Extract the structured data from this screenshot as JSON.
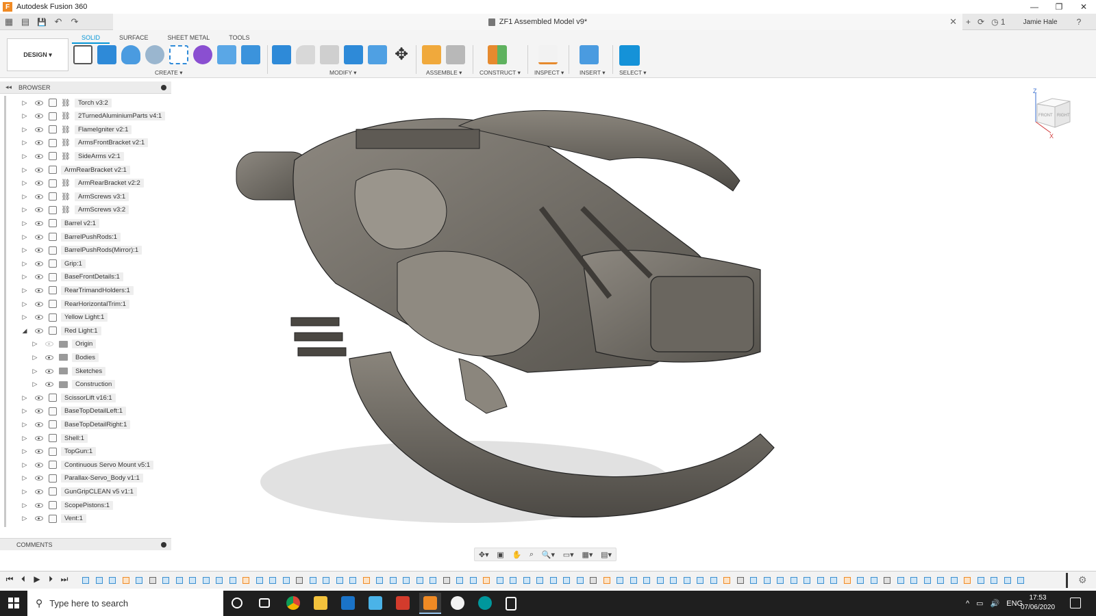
{
  "window": {
    "app_title": "Autodesk Fusion 360",
    "minimize": "—",
    "restore": "❐",
    "close": "✕"
  },
  "quickaccess": {
    "grid_icon": "▦",
    "file_icon": "▤",
    "save_icon": "💾",
    "undo_icon": "↶",
    "redo_icon": "↷"
  },
  "doc": {
    "title": "ZF1 Assembled Model v9*",
    "close": "✕"
  },
  "topright": {
    "new_tab": "+",
    "job_icon": "⟳",
    "notifications": "◷ 1",
    "user": "Jamie Hale",
    "help": "?"
  },
  "ribbon": {
    "workspace": "DESIGN ▾",
    "tabs": [
      "SOLID",
      "SURFACE",
      "SHEET METAL",
      "TOOLS"
    ],
    "groups": {
      "create": "CREATE ▾",
      "modify": "MODIFY ▾",
      "assemble": "ASSEMBLE ▾",
      "construct": "CONSTRUCT ▾",
      "inspect": "INSPECT ▾",
      "insert": "INSERT ▾",
      "select": "SELECT ▾"
    }
  },
  "browser": {
    "title": "BROWSER",
    "collapse": "◂◂",
    "items": [
      {
        "label": "Torch v3:2",
        "link": true,
        "expanded": false,
        "depth": 0
      },
      {
        "label": "2TurnedAluminiumParts v4:1",
        "link": true,
        "expanded": false,
        "depth": 0
      },
      {
        "label": "FlameIgniter v2:1",
        "link": true,
        "expanded": false,
        "depth": 0
      },
      {
        "label": "ArmsFrontBracket v2:1",
        "link": true,
        "expanded": false,
        "depth": 0
      },
      {
        "label": "SideArms v2:1",
        "link": true,
        "expanded": false,
        "depth": 0
      },
      {
        "label": "ArmRearBracket v2:1",
        "link": false,
        "expanded": false,
        "depth": 0
      },
      {
        "label": "ArmRearBracket v2:2",
        "link": true,
        "expanded": false,
        "depth": 0
      },
      {
        "label": "ArmScrews v3:1",
        "link": true,
        "expanded": false,
        "depth": 0
      },
      {
        "label": "ArmScrews v3:2",
        "link": true,
        "expanded": false,
        "depth": 0
      },
      {
        "label": "Barrel v2:1",
        "link": false,
        "expanded": false,
        "depth": 0
      },
      {
        "label": "BarrelPushRods:1",
        "link": false,
        "expanded": false,
        "depth": 0
      },
      {
        "label": "BarrelPushRods(Mirror):1",
        "link": false,
        "expanded": false,
        "depth": 0
      },
      {
        "label": "Grip:1",
        "link": false,
        "expanded": false,
        "depth": 0
      },
      {
        "label": "BaseFrontDetails:1",
        "link": false,
        "expanded": false,
        "depth": 0
      },
      {
        "label": "RearTrimandHolders:1",
        "link": false,
        "expanded": false,
        "depth": 0
      },
      {
        "label": "RearHorizontalTrim:1",
        "link": false,
        "expanded": false,
        "depth": 0
      },
      {
        "label": "Yellow Light:1",
        "link": false,
        "expanded": false,
        "depth": 0
      },
      {
        "label": "Red Light:1",
        "link": false,
        "expanded": true,
        "depth": 0
      },
      {
        "label": "Origin",
        "link": false,
        "expanded": false,
        "depth": 1,
        "folder": true,
        "hidden": true
      },
      {
        "label": "Bodies",
        "link": false,
        "expanded": false,
        "depth": 1,
        "folder": true
      },
      {
        "label": "Sketches",
        "link": false,
        "expanded": false,
        "depth": 1,
        "folder": true
      },
      {
        "label": "Construction",
        "link": false,
        "expanded": false,
        "depth": 1,
        "folder": true
      },
      {
        "label": "ScissorLift v16:1",
        "link": false,
        "expanded": false,
        "depth": 0
      },
      {
        "label": "BaseTopDetailLeft:1",
        "link": false,
        "expanded": false,
        "depth": 0
      },
      {
        "label": "BaseTopDetailRight:1",
        "link": false,
        "expanded": false,
        "depth": 0
      },
      {
        "label": "Shell:1",
        "link": false,
        "expanded": false,
        "depth": 0
      },
      {
        "label": "TopGun:1",
        "link": false,
        "expanded": false,
        "depth": 0
      },
      {
        "label": "Continuous Servo Mount v5:1",
        "link": false,
        "expanded": false,
        "depth": 0
      },
      {
        "label": "Parallax-Servo_Body v1:1",
        "link": false,
        "expanded": false,
        "depth": 0
      },
      {
        "label": "GunGripCLEAN v5 v1:1",
        "link": false,
        "expanded": false,
        "depth": 0
      },
      {
        "label": "ScopePistons:1",
        "link": false,
        "expanded": false,
        "depth": 0
      },
      {
        "label": "Vent:1",
        "link": false,
        "expanded": false,
        "depth": 0
      }
    ]
  },
  "comments": {
    "title": "COMMENTS"
  },
  "viewcube": {
    "front": "FRONT",
    "right": "RIGHT",
    "z": "Z",
    "x": "X"
  },
  "navbar": {
    "orbit": "✥▾",
    "look": "▣",
    "pan": "✋",
    "zoom_fit": "⌕",
    "zoom": "🔍▾",
    "display": "▭▾",
    "grid": "▦▾",
    "viewports": "▤▾"
  },
  "timeline": {
    "first": "⏮",
    "prev": "⏴",
    "play": "▶",
    "next": "⏵",
    "last": "⏭",
    "settings": "⚙"
  },
  "taskbar": {
    "search_placeholder": "Type here to search",
    "search_icon": "⚲",
    "tray": {
      "chevron": "^",
      "network": "▭",
      "volume": "🔊",
      "lang": "ENG"
    },
    "time": "17:53",
    "date": "07/06/2020"
  },
  "colors": {
    "accent": "#0696d7",
    "model": "#7a756c",
    "taskbar": "#1f1f1f"
  }
}
